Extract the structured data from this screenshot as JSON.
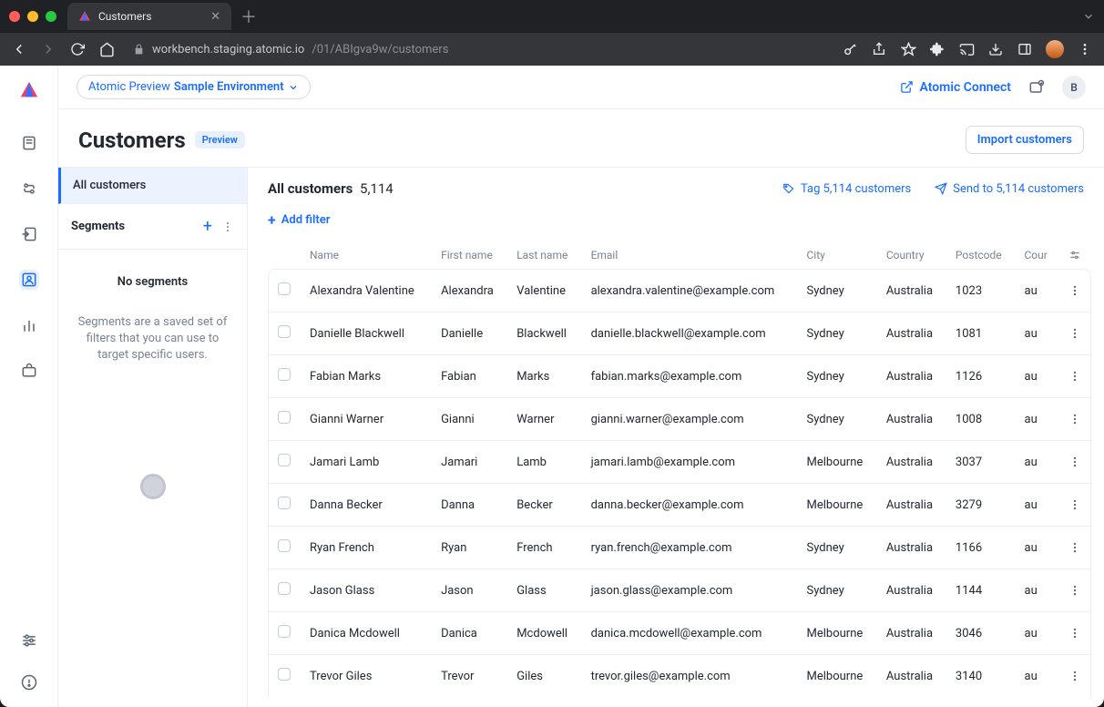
{
  "browser": {
    "tab_title": "Customers",
    "url_host": "workbench.staging.atomic.io",
    "url_path": "/01/ABIgva9w/customers"
  },
  "topbar": {
    "env_prefix": "Atomic Preview",
    "env_name": "Sample Environment",
    "connect_label": "Atomic Connect",
    "user_initial": "B"
  },
  "header": {
    "title": "Customers",
    "badge": "Preview",
    "import_label": "Import customers"
  },
  "left_panel": {
    "all_label": "All customers",
    "segments_label": "Segments",
    "empty_title": "No segments",
    "empty_desc": "Segments are a saved set of filters that you can use to target specific users."
  },
  "content_head": {
    "title_bold": "All customers",
    "count": "5,114",
    "tag_label": "Tag 5,114 customers",
    "send_label": "Send to 5,114 customers",
    "add_filter": "Add filter"
  },
  "columns": [
    "Name",
    "First name",
    "Last name",
    "Email",
    "City",
    "Country",
    "Postcode",
    "Cour"
  ],
  "rows": [
    {
      "name": "Alexandra Valentine",
      "first": "Alexandra",
      "last": "Valentine",
      "email": "alexandra.valentine@example.com",
      "city": "Sydney",
      "country": "Australia",
      "postcode": "1023",
      "cour": "au"
    },
    {
      "name": "Danielle Blackwell",
      "first": "Danielle",
      "last": "Blackwell",
      "email": "danielle.blackwell@example.com",
      "city": "Sydney",
      "country": "Australia",
      "postcode": "1081",
      "cour": "au"
    },
    {
      "name": "Fabian Marks",
      "first": "Fabian",
      "last": "Marks",
      "email": "fabian.marks@example.com",
      "city": "Sydney",
      "country": "Australia",
      "postcode": "1126",
      "cour": "au"
    },
    {
      "name": "Gianni Warner",
      "first": "Gianni",
      "last": "Warner",
      "email": "gianni.warner@example.com",
      "city": "Sydney",
      "country": "Australia",
      "postcode": "1008",
      "cour": "au"
    },
    {
      "name": "Jamari Lamb",
      "first": "Jamari",
      "last": "Lamb",
      "email": "jamari.lamb@example.com",
      "city": "Melbourne",
      "country": "Australia",
      "postcode": "3037",
      "cour": "au"
    },
    {
      "name": "Danna Becker",
      "first": "Danna",
      "last": "Becker",
      "email": "danna.becker@example.com",
      "city": "Melbourne",
      "country": "Australia",
      "postcode": "3279",
      "cour": "au"
    },
    {
      "name": "Ryan French",
      "first": "Ryan",
      "last": "French",
      "email": "ryan.french@example.com",
      "city": "Sydney",
      "country": "Australia",
      "postcode": "1166",
      "cour": "au"
    },
    {
      "name": "Jason Glass",
      "first": "Jason",
      "last": "Glass",
      "email": "jason.glass@example.com",
      "city": "Sydney",
      "country": "Australia",
      "postcode": "1144",
      "cour": "au"
    },
    {
      "name": "Danica Mcdowell",
      "first": "Danica",
      "last": "Mcdowell",
      "email": "danica.mcdowell@example.com",
      "city": "Melbourne",
      "country": "Australia",
      "postcode": "3046",
      "cour": "au"
    },
    {
      "name": "Trevor Giles",
      "first": "Trevor",
      "last": "Giles",
      "email": "trevor.giles@example.com",
      "city": "Melbourne",
      "country": "Australia",
      "postcode": "3140",
      "cour": "au"
    }
  ]
}
